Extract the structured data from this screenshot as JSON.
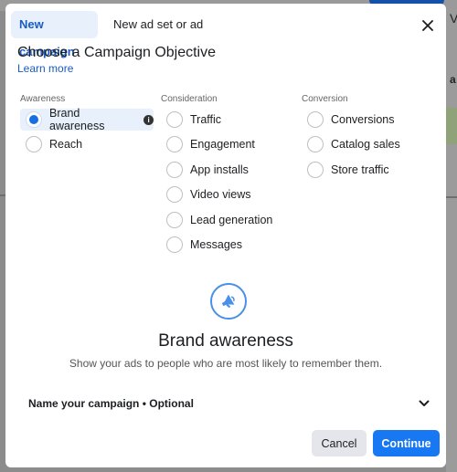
{
  "tabs": [
    {
      "label": "New campaign",
      "active": true
    },
    {
      "label": "New ad set or ad",
      "active": false
    }
  ],
  "header": {
    "title": "Choose a Campaign Objective",
    "learn_more": "Learn more"
  },
  "columns": [
    {
      "heading": "Awareness",
      "options": [
        {
          "label": "Brand awareness",
          "selected": true,
          "info": true
        },
        {
          "label": "Reach",
          "selected": false
        }
      ]
    },
    {
      "heading": "Consideration",
      "options": [
        {
          "label": "Traffic",
          "selected": false
        },
        {
          "label": "Engagement",
          "selected": false
        },
        {
          "label": "App installs",
          "selected": false
        },
        {
          "label": "Video views",
          "selected": false
        },
        {
          "label": "Lead generation",
          "selected": false
        },
        {
          "label": "Messages",
          "selected": false
        }
      ]
    },
    {
      "heading": "Conversion",
      "options": [
        {
          "label": "Conversions",
          "selected": false
        },
        {
          "label": "Catalog sales",
          "selected": false
        },
        {
          "label": "Store traffic",
          "selected": false
        }
      ]
    }
  ],
  "icons": {
    "close": "close-icon",
    "info": "info-icon",
    "feature": "megaphone-icon",
    "expand": "chevron-down-icon"
  },
  "info_glyph": "i",
  "feature": {
    "title": "Brand awareness",
    "description": "Show your ads to people who are most likely to remember them."
  },
  "name_campaign": {
    "label": "Name your campaign • Optional"
  },
  "footer": {
    "cancel": "Cancel",
    "continue": "Continue"
  },
  "background": {
    "glyph_right_top": "V",
    "glyph_right_mid": "a"
  },
  "colors": {
    "accent": "#1877f2",
    "tab_active_bg": "#e7f0fb",
    "link": "#1a5bc4",
    "radio_selected": "#1a6fe0"
  }
}
